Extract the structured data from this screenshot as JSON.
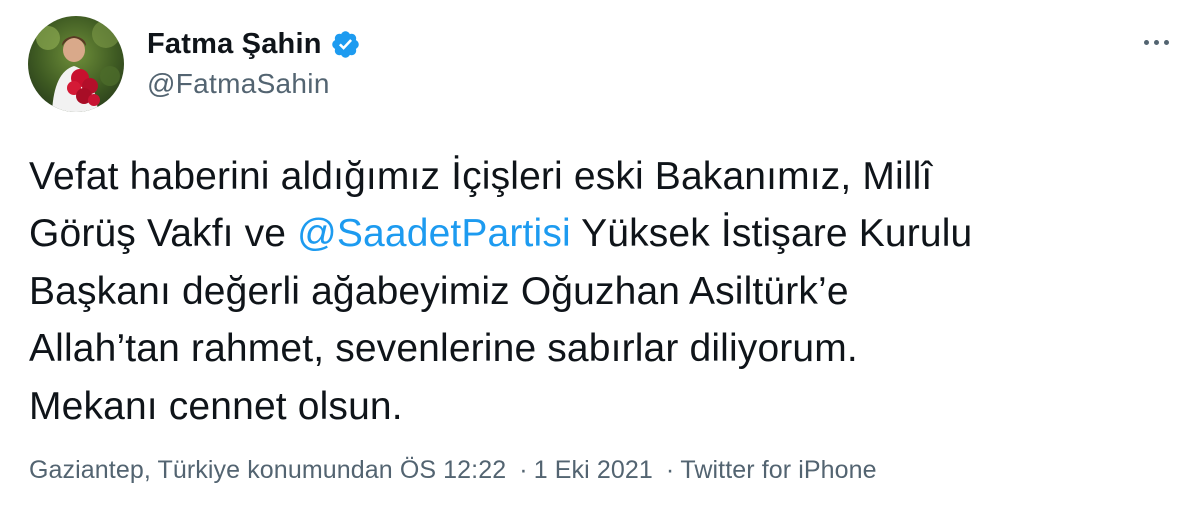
{
  "author": {
    "display_name": "Fatma Şahin",
    "handle": "@FatmaSahin",
    "verified": true,
    "avatar_icon": "profile-photo-icon"
  },
  "tweet": {
    "line1": "Vefat haberini aldığımız İçişleri eski Bakanımız, Millî",
    "line2_before": "Görüş Vakfı ve ",
    "line2_mention": "@SaadetPartisi",
    "line2_after": " Yüksek İstişare Kurulu",
    "line3": "Başkanı değerli ağabeyimiz Oğuzhan Asiltürk’e",
    "line4": "Allah’tan rahmet, sevenlerine sabırlar diliyorum.",
    "line5": "Mekanı cennet olsun."
  },
  "meta": {
    "location": "Gaziantep, Türkiye konumundan",
    "time": "ÖS 12:22",
    "separator": "·",
    "date": "1 Eki 2021",
    "source": "Twitter for iPhone"
  },
  "colors": {
    "text": "#0f1419",
    "secondary": "#536471",
    "accent": "#1d9bf0"
  },
  "icons": {
    "verified": "verified-badge-icon",
    "more": "more-options-icon"
  }
}
